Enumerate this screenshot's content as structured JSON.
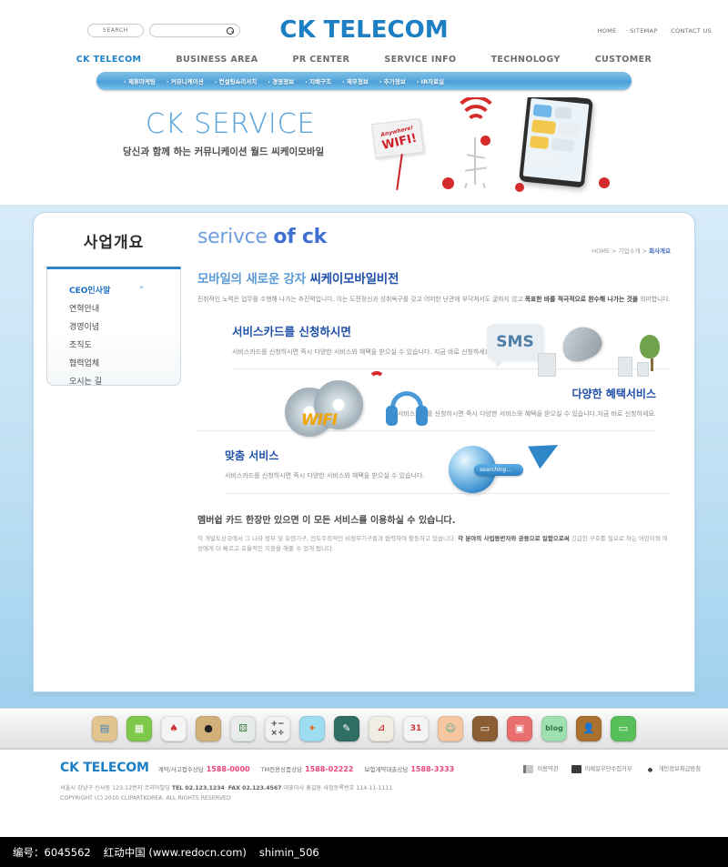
{
  "header": {
    "search_button_label": "SEARCH",
    "search_placeholder": "",
    "search_value": "",
    "search_icon": "magnifier-icon",
    "brand_part1": "CK ",
    "brand_part2": "TELECOM",
    "brand_full": "CK TELECOM",
    "util_links": [
      "HOME",
      "SITEMAP",
      "CONTACT US"
    ]
  },
  "mainnav": {
    "items": [
      {
        "label": "CK TELECOM",
        "active": true
      },
      {
        "label": "BUSINESS AREA",
        "active": false
      },
      {
        "label": "PR CENTER",
        "active": false
      },
      {
        "label": "SERVICE INFO",
        "active": false
      },
      {
        "label": "TECHNOLOGY",
        "active": false
      },
      {
        "label": "CUSTOMER",
        "active": false
      }
    ]
  },
  "subnav": {
    "items": [
      "제휴마케팅",
      "커뮤니케이션",
      "컨설팅&리서치",
      "경영정보",
      "지배구조",
      "재무정보",
      "추가정보",
      "IR자료실"
    ]
  },
  "hero": {
    "title": "CK SERVICE",
    "subtitle": "당신과 함께 하는 커뮤니케이션 월드 씨케이모바일",
    "sign_line1": "Anywhere!",
    "sign_line2": "WIFI!",
    "art_items": [
      "wifi-signal-icon",
      "antenna-tower-icon",
      "tablet-device-icon",
      "wifi-sign-icon"
    ]
  },
  "sidebar": {
    "title": "사업개요",
    "items": [
      {
        "label": "CEO인사말",
        "selected": true
      },
      {
        "label": "연혁안내",
        "selected": false
      },
      {
        "label": "경영이념",
        "selected": false
      },
      {
        "label": "조직도",
        "selected": false
      },
      {
        "label": "협력업체",
        "selected": false
      },
      {
        "label": "오시는 길",
        "selected": false
      }
    ]
  },
  "main": {
    "page_title_light": "serivce ",
    "page_title_bold": "of ck",
    "breadcrumb_home": "HOME",
    "breadcrumb_mid": "기업소개",
    "breadcrumb_current": "회사개요",
    "lede_heading_light": "모바일의 새로운 강자 ",
    "lede_heading_bold": "씨케이모바일비전",
    "lede_para_1": "진취적인 노력은 업무를 수행해 나가는 추진력입니다. 이는 도전정신과 성취욕구를 갖고 어떠한 난관에 부닥쳐서도 굴하지 않고 ",
    "lede_para_bold": "목표한 바를 적극적으로 완수해 나가는 것을",
    "lede_para_2": " 의미합니다.",
    "sections": [
      {
        "title": "서비스카드를 신청하시면",
        "body": "서비스카드를 신청하시면 즉시 다양한 서비스와 혜택을 받으실 수 있습니다. 지금 바로 신청하세요.",
        "align": "left",
        "art": "sms-bubble-and-satellite-dish"
      },
      {
        "title": "다양한 혜택서비스",
        "body": "서비스카드를 신청하시면 즉시 다양한 서비스와 혜택을 받으실 수 있습니다.지금 바로 신청하세요.",
        "align": "right",
        "art": "cd-headphones-wifi"
      },
      {
        "title": "맞춤 서비스",
        "body": "서비스카드를 신청하시면 즉시 다양한 서비스와 혜택을 받으실 수 있습니다.",
        "align": "left",
        "art": "globe-search-arrow"
      }
    ],
    "sms_label": "SMS",
    "wifi_label": "WIFI",
    "searching_label": "searching...",
    "closing_heading_bold": "멤버쉽 카드 한장만 있으면",
    "closing_heading_rest": " 이 모든 서비스를 이용하실 수 있습니다.",
    "closing_para_1": "각 개발도상국에서 그 나라 정부 및 유엔기구, 인도주의적인 비정부기구들과 협력하여 활동하고 있습니다. ",
    "closing_para_bold": "각 분야의 사업동반자와 공동으로 일함으로써",
    "closing_para_2": " 긴급한 구호를 필요로 하는 어린이와 여성에게 더 빠르고 효율적인 지원을 해줄 수 있게 됩니다."
  },
  "dock": {
    "icons": [
      {
        "name": "abacus-icon",
        "label": "",
        "bg": "#e2c48f"
      },
      {
        "name": "tetris-icon",
        "label": "",
        "bg": "#7ec84a"
      },
      {
        "name": "playing-cards-icon",
        "label": "",
        "bg": "#f4f4f4"
      },
      {
        "name": "go-board-icon",
        "label": "",
        "bg": "#d3b07a"
      },
      {
        "name": "dice-icon",
        "label": "",
        "bg": "#e8ebec"
      },
      {
        "name": "calculator-icon",
        "label": "",
        "bg": "#f2f2f2"
      },
      {
        "name": "puzzle-icon",
        "label": "",
        "bg": "#9edcf0"
      },
      {
        "name": "chalkboard-icon",
        "label": "",
        "bg": "#2f6e64"
      },
      {
        "name": "ruler-icon",
        "label": "",
        "bg": "#f0ede3"
      },
      {
        "name": "calendar-icon",
        "label": "",
        "bg": "#f3f4f6"
      },
      {
        "name": "character-icon",
        "label": "",
        "bg": "#f5c6a0"
      },
      {
        "name": "briefcase-icon",
        "label": "",
        "bg": "#8a5d33"
      },
      {
        "name": "notebook-icon",
        "label": "",
        "bg": "#e96f6f"
      },
      {
        "name": "blog-icon",
        "label": "blog",
        "bg": "#9fe0b0"
      },
      {
        "name": "address-book-icon",
        "label": "",
        "bg": "#a9702e"
      },
      {
        "name": "battery-icon",
        "label": "",
        "bg": "#57c05a"
      }
    ]
  },
  "footer": {
    "logo": "CK TELECOM",
    "tels": [
      {
        "label": "계약/사고접수상담",
        "number": "1588-0000"
      },
      {
        "label": "TM전용상품상담",
        "number": "1588-02222"
      },
      {
        "label": "보험계약대출상담",
        "number": "1588-3333"
      }
    ],
    "links": [
      {
        "icon": "document-icon",
        "label": "이용약관"
      },
      {
        "icon": "envelope-icon",
        "label": "이메일무단수집거부"
      },
      {
        "icon": "eye-icon",
        "label": "개인정보취급방침"
      }
    ],
    "address": "서울시 강남구 신사동 123-12번지 코리아빌딩 ",
    "tel_label": "TEL 02.123.1234",
    "fax_label": "FAX 02.123.4567",
    "ceo_label": " 대표이사 홍길동 사업등록번호 114-11-1111",
    "copyright": "COPYRIGHT (C) 2010 CLIPARTKOREA. ALL RIGHTS RESERVED"
  },
  "watermark": {
    "id_label": "编号：6045562",
    "site_label": "红动中国 (www.redocn.com)",
    "user_label": "shimin_506"
  }
}
